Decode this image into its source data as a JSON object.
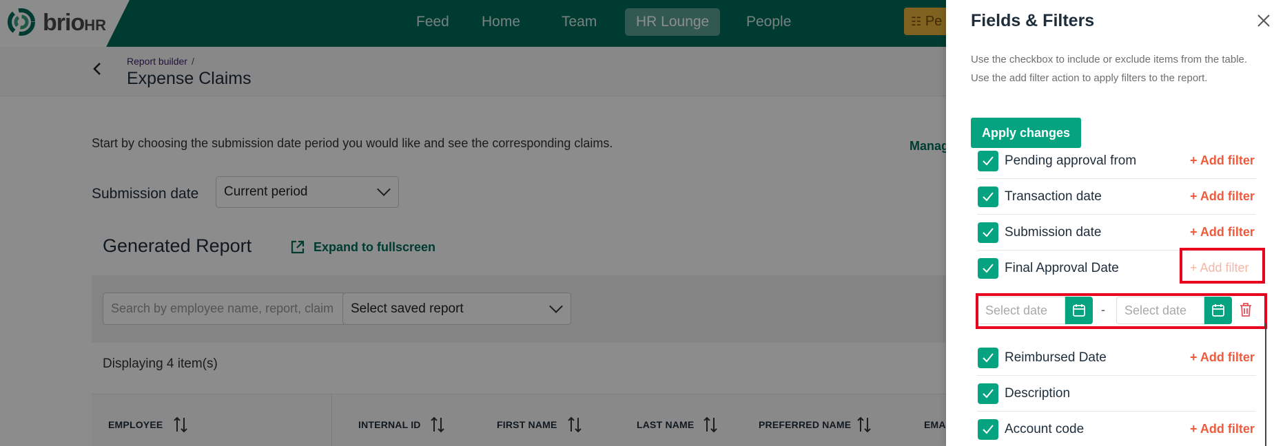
{
  "brand": {
    "name": "brio",
    "suffix": "HR"
  },
  "nav": [
    {
      "label": "Feed",
      "active": false
    },
    {
      "label": "Home",
      "active": false
    },
    {
      "label": "Team",
      "active": false
    },
    {
      "label": "HR Lounge",
      "active": true
    },
    {
      "label": "People",
      "active": false
    }
  ],
  "nav_extra": {
    "label": "Pe",
    "icon": "checklist-icon"
  },
  "breadcrumb": {
    "parent": "Report builder",
    "separator": "/"
  },
  "page_title": "Expense Claims",
  "intro_text": "Start by choosing the submission date period you would like and see the corresponding claims.",
  "manage_link": "Manag",
  "submission_date": {
    "label": "Submission date",
    "value": "Current period"
  },
  "report": {
    "title": "Generated Report",
    "expand_label": "Expand to fullscreen",
    "search_placeholder": "Search by employee name, report, claim",
    "saved_report_placeholder": "Select saved report",
    "displaying": "Displaying 4 item(s)",
    "columns": [
      "EMPLOYEE",
      "INTERNAL ID",
      "FIRST NAME",
      "LAST NAME",
      "PREFERRED NAME",
      "EMA"
    ]
  },
  "panel": {
    "title": "Fields & Filters",
    "description": "Use the checkbox to include or exclude items from the table. Use the add filter action to apply filters to the report.",
    "apply_label": "Apply changes",
    "add_filter_label": "+ Add filter",
    "fields": [
      {
        "label": "Pending approval from",
        "checked": true,
        "filter": true
      },
      {
        "label": "Transaction date",
        "checked": true,
        "filter": true
      },
      {
        "label": "Submission date",
        "checked": true,
        "filter": true
      },
      {
        "label": "Final Approval Date",
        "checked": true,
        "filter": true,
        "filter_disabled": true
      },
      {
        "label": "Reimbursed Date",
        "checked": true,
        "filter": true
      },
      {
        "label": "Description",
        "checked": true,
        "filter": false
      },
      {
        "label": "Account code",
        "checked": true,
        "filter": true
      }
    ],
    "date_filter": {
      "from_placeholder": "Select date",
      "to_placeholder": "Select date",
      "separator": "-"
    }
  },
  "colors": {
    "brand": "#016c5a",
    "accent": "#05a380",
    "add_filter": "#f05a3c",
    "highlight": "#e8001f"
  }
}
